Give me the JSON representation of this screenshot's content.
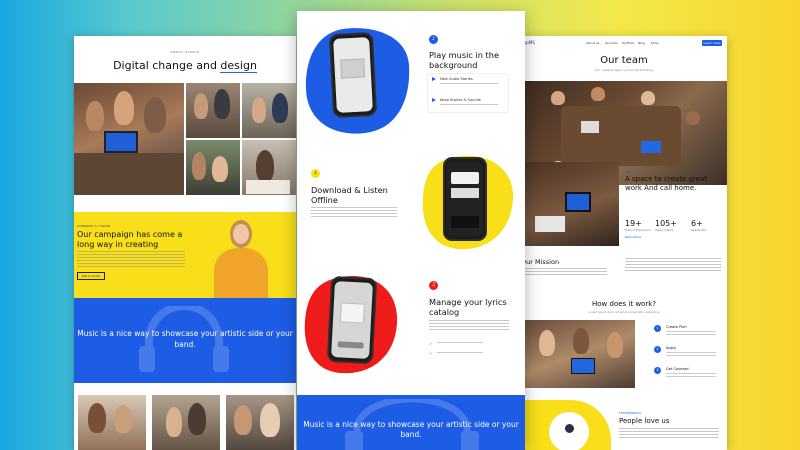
{
  "left_page": {
    "kicker": "ABOUT STUDIO",
    "title_prefix": "Digital change and ",
    "title_highlight": "design",
    "section_kicker": "COMPANY'S VISION",
    "section_title": "Our campaign has come a long way in creating",
    "section_button": "Get in touch",
    "banner_text": "Music is a nice way to showcase your artistic side or your band."
  },
  "center_page": {
    "feature1": {
      "title": "Play music in the background",
      "items": [
        "New Audio Stories",
        "Keep Stories & Sounds"
      ]
    },
    "feature2": {
      "title": "Download & Listen Offline"
    },
    "feature3": {
      "title": "Manage your lyrics catalog"
    },
    "banner_text": "Music is a nice way to showcase your artistic side or your band."
  },
  "right_page": {
    "logo": "AppMS",
    "nav": [
      "About us",
      "Services",
      "Portfolio",
      "Blog",
      "Shop"
    ],
    "nav_cta": "Learn more",
    "title": "Our team",
    "subtitle": "Our creative agency since its founding",
    "about_kicker": "ABOUT US",
    "about_title": "A space to create great work And call home.",
    "stats": [
      {
        "value": "19+",
        "label": "Years of Experience"
      },
      {
        "value": "105+",
        "label": "Happy Clients"
      },
      {
        "value": "6+",
        "label": "Awards Won"
      }
    ],
    "read_more": "Read More",
    "mission_title": "Our Mission",
    "how_title": "How does it work?",
    "how_subtitle": "Lorem ipsum dolor sit amet consectetur adipiscing",
    "steps": [
      "Create Plan",
      "Apply",
      "Get Covered"
    ],
    "testimonials_kicker": "TESTIMONIALS",
    "testimonials_title": "People love us"
  },
  "colors": {
    "accent_blue": "#1d5ce5",
    "accent_yellow": "#f8df19",
    "accent_red": "#ee1b1b"
  }
}
